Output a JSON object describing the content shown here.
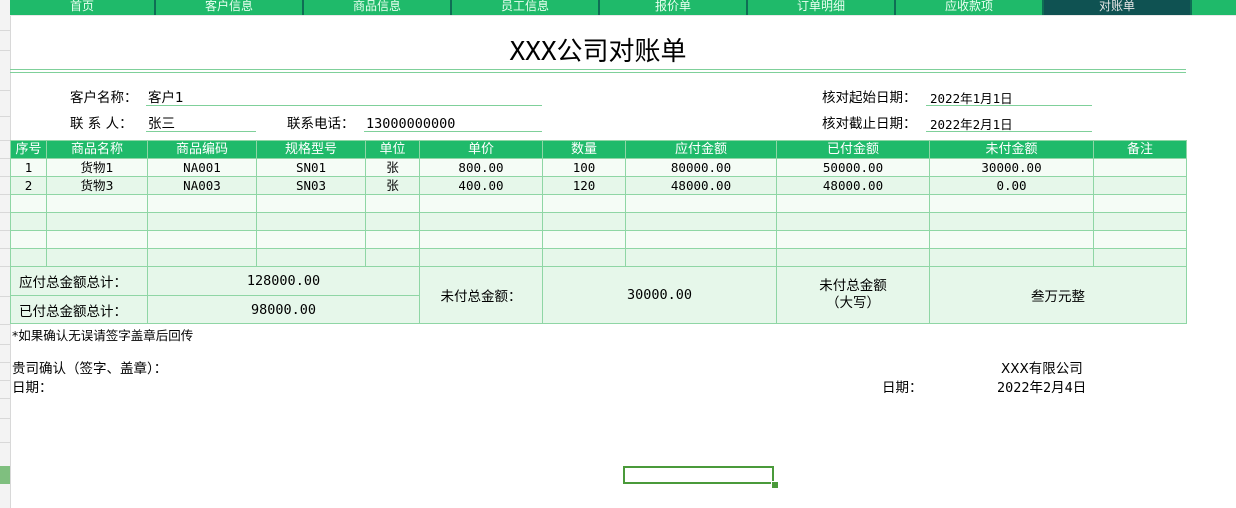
{
  "tabs": [
    {
      "label": "首页",
      "active": false
    },
    {
      "label": "客户信息",
      "active": false
    },
    {
      "label": "商品信息",
      "active": false
    },
    {
      "label": "员工信息",
      "active": false
    },
    {
      "label": "报价单",
      "active": false
    },
    {
      "label": "订单明细",
      "active": false
    },
    {
      "label": "应收款项",
      "active": false
    },
    {
      "label": "对账单",
      "active": true
    },
    {
      "label": "",
      "active": false
    }
  ],
  "statement": {
    "title": "XXX公司对账单",
    "customer_name_label": "客户名称：",
    "customer_name": "客户1",
    "contact_label": "联 系 人：",
    "contact": "张三",
    "phone_label": "联系电话：",
    "phone": "13000000000",
    "start_date_label": "核对起始日期：",
    "start_date": "2022年1月1日",
    "end_date_label": "核对截止日期：",
    "end_date": "2022年2月1日"
  },
  "table": {
    "headers": [
      "序号",
      "商品名称",
      "商品编码",
      "规格型号",
      "单位",
      "单价",
      "数量",
      "应付金额",
      "已付金额",
      "未付金额",
      "备注"
    ],
    "rows": [
      [
        "1",
        "货物1",
        "NA001",
        "SN01",
        "张",
        "800.00",
        "100",
        "80000.00",
        "50000.00",
        "30000.00",
        ""
      ],
      [
        "2",
        "货物3",
        "NA003",
        "SN03",
        "张",
        "400.00",
        "120",
        "48000.00",
        "48000.00",
        "0.00",
        ""
      ],
      [
        "",
        "",
        "",
        "",
        "",
        "",
        "",
        "",
        "",
        "",
        ""
      ],
      [
        "",
        "",
        "",
        "",
        "",
        "",
        "",
        "",
        "",
        "",
        ""
      ],
      [
        "",
        "",
        "",
        "",
        "",
        "",
        "",
        "",
        "",
        "",
        ""
      ],
      [
        "",
        "",
        "",
        "",
        "",
        "",
        "",
        "",
        "",
        "",
        ""
      ]
    ]
  },
  "totals": {
    "payable_total_label": "应付总金额总计：",
    "payable_total": "128000.00",
    "paid_total_label": "已付总金额总计：",
    "paid_total": "98000.00",
    "unpaid_total_label": "未付总金额：",
    "unpaid_total": "30000.00",
    "unpaid_upper_label": "未付总金额",
    "unpaid_upper_label2": "（大写）",
    "unpaid_upper": "叁万元整"
  },
  "footer": {
    "note": "*如果确认无误请签字盖章后回传",
    "confirm_label": "贵司确认（签字、盖章）：",
    "date_label_left": "日期：",
    "company": "XXX有限公司",
    "date_label_right": "日期：",
    "date": "2022年2月4日"
  },
  "colors": {
    "header_green": "#1fba6a",
    "active_tab": "#0f5252",
    "row_light": "#f5fcf6",
    "row_tint": "#e6f7ea",
    "border": "#8fd6a5"
  }
}
